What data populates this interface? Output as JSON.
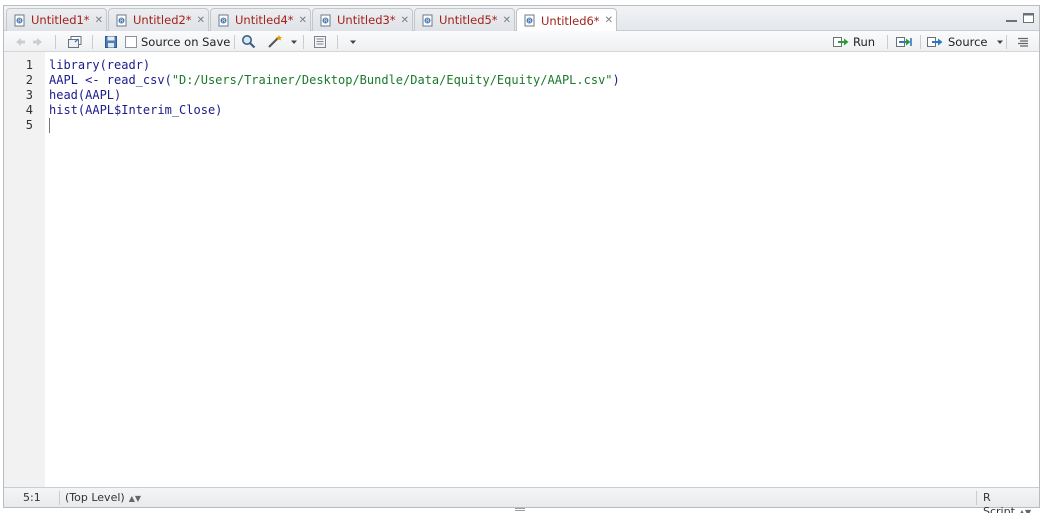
{
  "tabs": [
    {
      "label": "Untitled1*"
    },
    {
      "label": "Untitled2*"
    },
    {
      "label": "Untitled4*"
    },
    {
      "label": "Untitled3*"
    },
    {
      "label": "Untitled5*"
    },
    {
      "label": "Untitled6*"
    }
  ],
  "toolbar": {
    "source_on_save_label": "Source on Save",
    "run_label": "Run",
    "source_label": "Source"
  },
  "editor": {
    "line_numbers": [
      "1",
      "2",
      "3",
      "4",
      "5"
    ],
    "lines": [
      {
        "code": "library(readr)"
      },
      {
        "code_before": "AAPL <- read_csv(",
        "string": "\"D:/Users/Trainer/Desktop/Bundle/Data/Equity/Equity/AAPL.csv\"",
        "code_after": ")"
      },
      {
        "code": "head(AAPL)"
      },
      {
        "code": "hist(AAPL$Interim_Close)"
      },
      {
        "code": ""
      }
    ]
  },
  "status": {
    "position": "5:1",
    "scope": "(Top Level)",
    "file_type": "R Script"
  },
  "colors": {
    "tab_label": "#a3221c",
    "code_text": "#1b1b8a",
    "string_text": "#1a7a2a",
    "gutter_bg": "#f2f2f2"
  }
}
